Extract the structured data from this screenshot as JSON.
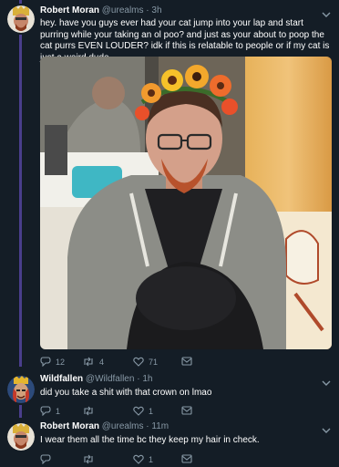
{
  "tweets": [
    {
      "name": "Robert Moran",
      "handle": "@urealms",
      "time": "· 3h",
      "text": "hey. have you guys ever had your cat jump into your lap and start purring while your taking an ol poo? and just as your about to poop the cat purrs EVEN LOUDER? idk if this is relatable to people or if my cat is just a weird dude.",
      "replies": "12",
      "retweets": "4",
      "likes": "71"
    },
    {
      "name": "Wildfallen",
      "handle": "@Wildfallen",
      "time": "· 1h",
      "text": "did you take a shit with that crown on lmao",
      "replies": "1",
      "retweets": "",
      "likes": "1"
    },
    {
      "name": "Robert Moran",
      "handle": "@urealms",
      "time": "· 11m",
      "text": "I wear them all the time bc they keep my hair in check.",
      "replies": "",
      "retweets": "",
      "likes": "1"
    }
  ],
  "colors": {
    "background": "#141d26",
    "thread_line": "#4a3e8c",
    "secondary_text": "#8899a6"
  },
  "icons": [
    "reply-icon",
    "retweet-icon",
    "like-icon",
    "message-icon",
    "chevron-down-icon"
  ]
}
